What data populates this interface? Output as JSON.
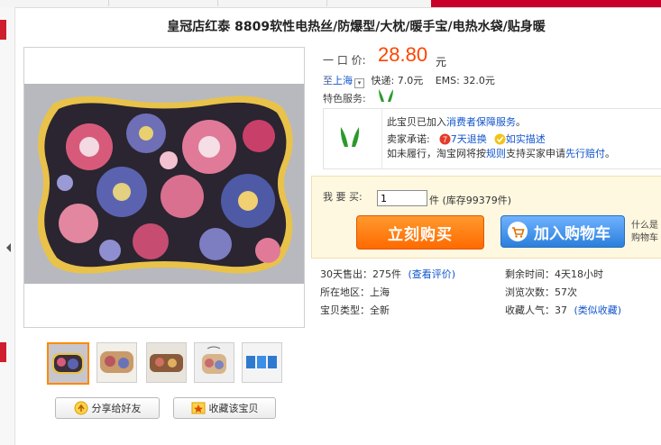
{
  "title": "皇冠店红泰 8809软性电热丝/防爆型/大枕/暖手宝/电热水袋/贴身暖",
  "price": {
    "label": "一 口 价:",
    "value": "28.80",
    "unit": "元"
  },
  "shipping": {
    "to_label": "至",
    "location": "上海",
    "kuaidi": "快递: 7.0元",
    "ems": "EMS: 32.0元"
  },
  "features": {
    "label": "特色服务:"
  },
  "guarantee": {
    "line1_prefix": "此宝贝已加入",
    "line1_link": "消费者保障服务",
    "line1_suffix": "。",
    "promise_label": "卖家承诺:",
    "promise_1": "7天退换",
    "promise_2": "如实描述",
    "line3_prefix": "如未履行，淘宝网将按",
    "line3_link1": "规则",
    "line3_mid": "支持买家申请",
    "line3_link2": "先行赔付",
    "line3_suffix": "。"
  },
  "buy": {
    "qty_label": "我 要 买:",
    "qty_value": "1",
    "unit": "件",
    "stock": "(库存99379件)",
    "buy_now": "立刻购买",
    "add_cart": "加入购物车",
    "side_1": "什么是",
    "side_2": "购物车"
  },
  "stats": {
    "sold": "30天售出：275件",
    "reviews": "(查看评价)",
    "time_left": "剩余时间：4天18小时",
    "region": "所在地区：上海",
    "views": "浏览次数：57次",
    "type": "宝贝类型：全新",
    "fav": "收藏人气：37",
    "fav_link": "(类似收藏)"
  },
  "actions": {
    "share": "分享给好友",
    "favorite": "收藏该宝贝"
  },
  "colors": {
    "price": "#ff4400",
    "buy": "#ff7a10",
    "cart": "#3d8ee8",
    "link": "#1155cc"
  }
}
